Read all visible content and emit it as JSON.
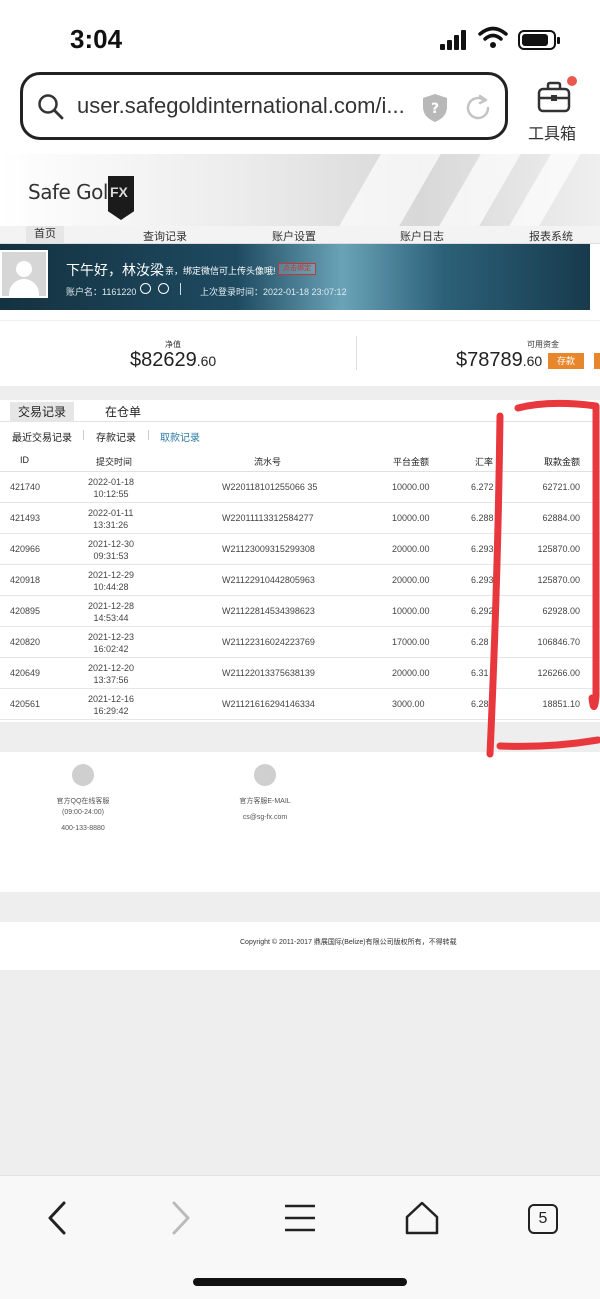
{
  "status_bar": {
    "time": "3:04"
  },
  "browser": {
    "url": "user.safegoldinternational.com/i...",
    "toolbox_label": "工具箱",
    "tabs_count": "5"
  },
  "site": {
    "logo_text": "Safe Gold",
    "logo_fx": "FX",
    "nav": [
      "首页",
      "查询记录",
      "账户设置",
      "账户日志",
      "报表系统"
    ],
    "greeting": "下午好，",
    "user_name": "林汝梁",
    "wechat_tip": "亲，绑定微信可上传头像哦!",
    "wechat_button": "点击绑定",
    "account_label": "账户名：1161220",
    "last_login": "上次登录时间：2022-01-18 23:07:12"
  },
  "balances": {
    "net_label": "净值",
    "net_main": "$82629",
    "net_cents": ".60",
    "avail_label": "可用资金",
    "avail_main": "$78789",
    "avail_cents": ".60",
    "deposit_button": "存款"
  },
  "tabs": [
    "交易记录",
    "在仓单"
  ],
  "subtabs": [
    "最近交易记录",
    "存款记录",
    "取款记录"
  ],
  "table": {
    "headers": [
      "ID",
      "提交时间",
      "流水号",
      "平台金额",
      "汇率",
      "取款金额"
    ],
    "rows": [
      {
        "id": "421740",
        "date": "2022-01-18",
        "time": "10:12:55",
        "serial": "W220118101255066 35",
        "amount": "10000.00",
        "rate": "6.272",
        "withdraw": "62721.00"
      },
      {
        "id": "421493",
        "date": "2022-01-11",
        "time": "13:31:26",
        "serial": "W22011113312584277",
        "amount": "10000.00",
        "rate": "6.288",
        "withdraw": "62884.00"
      },
      {
        "id": "420966",
        "date": "2021-12-30",
        "time": "09:31:53",
        "serial": "W21123009315299308",
        "amount": "20000.00",
        "rate": "6.293",
        "withdraw": "125870.00"
      },
      {
        "id": "420918",
        "date": "2021-12-29",
        "time": "10:44:28",
        "serial": "W21122910442805963",
        "amount": "20000.00",
        "rate": "6.293",
        "withdraw": "125870.00"
      },
      {
        "id": "420895",
        "date": "2021-12-28",
        "time": "14:53:44",
        "serial": "W21122814534398623",
        "amount": "10000.00",
        "rate": "6.292",
        "withdraw": "62928.00"
      },
      {
        "id": "420820",
        "date": "2021-12-23",
        "time": "16:02:42",
        "serial": "W21122316024223769",
        "amount": "17000.00",
        "rate": "6.28",
        "withdraw": "106846.70"
      },
      {
        "id": "420649",
        "date": "2021-12-20",
        "time": "13:37:56",
        "serial": "W21122013375638139",
        "amount": "20000.00",
        "rate": "6.31",
        "withdraw": "126266.00"
      },
      {
        "id": "420561",
        "date": "2021-12-16",
        "time": "16:29:42",
        "serial": "W21121616294146334",
        "amount": "3000.00",
        "rate": "6.28",
        "withdraw": "18851.10"
      }
    ]
  },
  "contact": {
    "qq_label": "官方QQ在线客服",
    "qq_hours": "(09:00-24:00)",
    "qq_phone": "400-133-8880",
    "email_label": "官方客服E-MAIL",
    "email": "cs@sg-fx.com"
  },
  "copyright": "Copyright © 2011-2017 鼎展国际(Belize)有限公司版权所有，不得转载",
  "colors": {
    "accent_blue": "#2d7ba6",
    "deposit_orange": "#e8862b",
    "annotation_red": "#e8383d"
  }
}
